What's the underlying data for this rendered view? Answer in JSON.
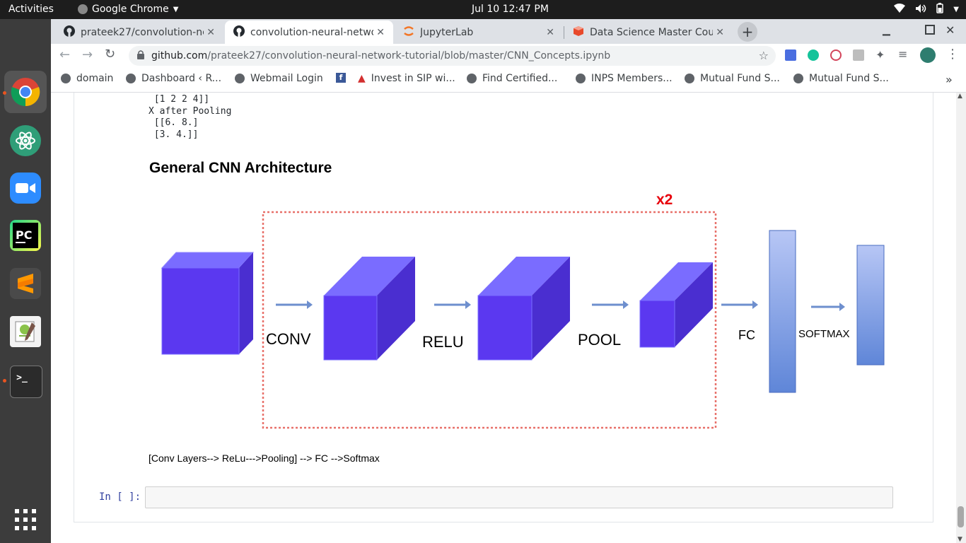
{
  "topbar": {
    "activities": "Activities",
    "app_name": "Google Chrome",
    "clock": "Jul 10  12:47 PM"
  },
  "dock": {
    "items": [
      "chrome-icon",
      "atom-icon",
      "zoom-icon",
      "pycharm-icon",
      "sublime-text-icon",
      "gedit-icon",
      "terminal-icon",
      "show-apps-icon"
    ]
  },
  "tabs": [
    {
      "title": "prateek27/convolution-ne",
      "icon": "github-icon",
      "active": false
    },
    {
      "title": "convolution-neural-netwo",
      "icon": "github-icon",
      "active": true
    },
    {
      "title": "JupyterLab",
      "icon": "jupyter-icon",
      "active": false
    },
    {
      "title": "Data Science Master Cour",
      "icon": "course-icon",
      "active": false
    }
  ],
  "omnibox": {
    "host": "github.com",
    "path": "/prateek27/convolution-neural-network-tutorial/blob/master/CNN_Concepts.ipynb"
  },
  "bookmarks": [
    {
      "label": "domain"
    },
    {
      "label": "Dashboard ‹ R..."
    },
    {
      "label": "Webmail Login"
    },
    {
      "label": ""
    },
    {
      "label": "Invest in SIP wi..."
    },
    {
      "label": "Find Certified..."
    },
    {
      "label": "INPS Members..."
    },
    {
      "label": "Mutual Fund S..."
    },
    {
      "label": "Mutual Fund S..."
    }
  ],
  "notebook": {
    "output_lines": [
      " [1 2 2 4]]",
      "X after Pooling",
      " [[6. 8.]",
      " [3. 4.]]"
    ],
    "heading": "General CNN Architecture",
    "diagram": {
      "repeat_label": "x2",
      "labels": [
        "CONV",
        "RELU",
        "POOL",
        "FC",
        "SOFTMAX"
      ]
    },
    "caption": "[Conv Layers--> ReLu--->Pooling] --> FC -->Softmax",
    "prompt": "In [ ]:"
  },
  "colors": {
    "cube_front": "#5b38f0",
    "cube_top": "#7a6cff",
    "cube_side": "#4a2ed0",
    "dashed_box": "#e8716a",
    "x2_red": "#e8000b",
    "arrow": "#6e8fce"
  }
}
